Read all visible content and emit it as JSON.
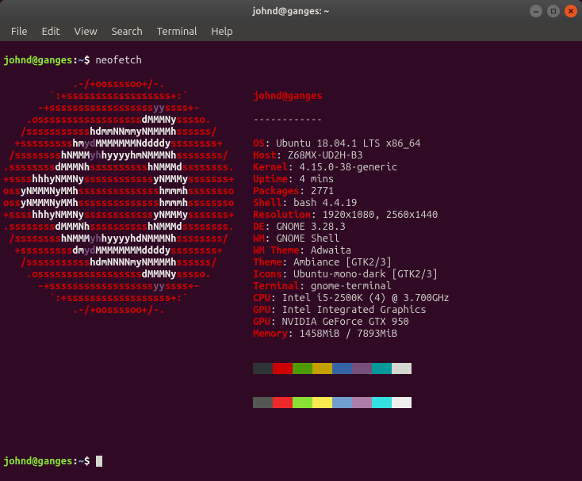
{
  "window": {
    "title": "johnd@ganges: ~"
  },
  "menu": {
    "items": [
      "File",
      "Edit",
      "View",
      "Search",
      "Terminal",
      "Help"
    ]
  },
  "prompt": {
    "user_host": "johnd@ganges",
    "separator": ":",
    "path": "~",
    "dollar": "$",
    "command": "neofetch"
  },
  "ascii": [
    [
      {
        "c": "c-red",
        "t": "            .-/+oossssoo+/-.            "
      }
    ],
    [
      {
        "c": "c-red",
        "t": "        `:+ssssssssssssssssss+:`        "
      }
    ],
    [
      {
        "c": "c-red",
        "t": "      -+ssssssssssssssssss"
      },
      {
        "c": "c-magenta",
        "t": "yy"
      },
      {
        "c": "c-red",
        "t": "ssss+-      "
      }
    ],
    [
      {
        "c": "c-red",
        "t": "    .ossssssssssssssssss"
      },
      {
        "c": "c-white",
        "t": "dMMMNy"
      },
      {
        "c": "c-red",
        "t": "sssso.    "
      }
    ],
    [
      {
        "c": "c-red",
        "t": "   /sssssssssss"
      },
      {
        "c": "c-white",
        "t": "hdmmNNmmyNMMMMh"
      },
      {
        "c": "c-red",
        "t": "ssssss/   "
      }
    ],
    [
      {
        "c": "c-red",
        "t": "  +sssssssss"
      },
      {
        "c": "c-white",
        "t": "hm"
      },
      {
        "c": "c-magenta",
        "t": "yd"
      },
      {
        "c": "c-white",
        "t": "MMMMMMMNddddy"
      },
      {
        "c": "c-red",
        "t": "ssssssss+  "
      }
    ],
    [
      {
        "c": "c-red",
        "t": " /ssssssss"
      },
      {
        "c": "c-white",
        "t": "hNMMM"
      },
      {
        "c": "c-magenta",
        "t": "yh"
      },
      {
        "c": "c-white",
        "t": "hyyyyhmNMMMNh"
      },
      {
        "c": "c-red",
        "t": "ssssssss/ "
      }
    ],
    [
      {
        "c": "c-red",
        "t": ".ssssssss"
      },
      {
        "c": "c-white",
        "t": "dMMMNh"
      },
      {
        "c": "c-red",
        "t": "ssssssssss"
      },
      {
        "c": "c-white",
        "t": "hNMMMd"
      },
      {
        "c": "c-red",
        "t": "ssssssss."
      }
    ],
    [
      {
        "c": "c-red",
        "t": "+ssss"
      },
      {
        "c": "c-white",
        "t": "hhhyNMMNy"
      },
      {
        "c": "c-red",
        "t": "ssssssssssss"
      },
      {
        "c": "c-white",
        "t": "yNMMMy"
      },
      {
        "c": "c-red",
        "t": "sssssss+"
      }
    ],
    [
      {
        "c": "c-red",
        "t": "oss"
      },
      {
        "c": "c-white",
        "t": "yNMMMNyMMh"
      },
      {
        "c": "c-red",
        "t": "ssssssssssssss"
      },
      {
        "c": "c-white",
        "t": "hmmmh"
      },
      {
        "c": "c-red",
        "t": "ssssssso"
      }
    ],
    [
      {
        "c": "c-red",
        "t": "oss"
      },
      {
        "c": "c-white",
        "t": "yNMMMNyMMh"
      },
      {
        "c": "c-red",
        "t": "ssssssssssssss"
      },
      {
        "c": "c-white",
        "t": "hmmmh"
      },
      {
        "c": "c-red",
        "t": "ssssssso"
      }
    ],
    [
      {
        "c": "c-red",
        "t": "+ssss"
      },
      {
        "c": "c-white",
        "t": "hhhyNMMNy"
      },
      {
        "c": "c-red",
        "t": "ssssssssssss"
      },
      {
        "c": "c-white",
        "t": "yNMMMy"
      },
      {
        "c": "c-red",
        "t": "sssssss+"
      }
    ],
    [
      {
        "c": "c-red",
        "t": ".ssssssss"
      },
      {
        "c": "c-white",
        "t": "dMMMNh"
      },
      {
        "c": "c-red",
        "t": "ssssssssss"
      },
      {
        "c": "c-white",
        "t": "hNMMMd"
      },
      {
        "c": "c-red",
        "t": "ssssssss."
      }
    ],
    [
      {
        "c": "c-red",
        "t": " /ssssssss"
      },
      {
        "c": "c-white",
        "t": "hNMMM"
      },
      {
        "c": "c-magenta",
        "t": "yh"
      },
      {
        "c": "c-white",
        "t": "hyyyyhdNMMMNh"
      },
      {
        "c": "c-red",
        "t": "ssssssss/ "
      }
    ],
    [
      {
        "c": "c-red",
        "t": "  +sssssssss"
      },
      {
        "c": "c-white",
        "t": "dm"
      },
      {
        "c": "c-magenta",
        "t": "yd"
      },
      {
        "c": "c-white",
        "t": "MMMMMMMMddddy"
      },
      {
        "c": "c-red",
        "t": "ssssssss+  "
      }
    ],
    [
      {
        "c": "c-red",
        "t": "   /sssssssssss"
      },
      {
        "c": "c-white",
        "t": "hdmNNNNmyNMMMMh"
      },
      {
        "c": "c-red",
        "t": "ssssss/   "
      }
    ],
    [
      {
        "c": "c-red",
        "t": "    .ossssssssssssssssss"
      },
      {
        "c": "c-white",
        "t": "dMMMNy"
      },
      {
        "c": "c-red",
        "t": "sssso.    "
      }
    ],
    [
      {
        "c": "c-red",
        "t": "      -+ssssssssssssssssss"
      },
      {
        "c": "c-magenta",
        "t": "yy"
      },
      {
        "c": "c-red",
        "t": "ssss+-      "
      }
    ],
    [
      {
        "c": "c-red",
        "t": "        `:+ssssssssssssssssss+:`        "
      }
    ],
    [
      {
        "c": "c-red",
        "t": "            .-/+oossssoo+/-.            "
      }
    ]
  ],
  "info": {
    "title": "johnd@ganges",
    "dashes": "------------",
    "rows": [
      {
        "label": "OS",
        "value": "Ubuntu 18.04.1 LTS x86_64"
      },
      {
        "label": "Host",
        "value": "Z68MX-UD2H-B3"
      },
      {
        "label": "Kernel",
        "value": "4.15.0-38-generic"
      },
      {
        "label": "Uptime",
        "value": "4 mins"
      },
      {
        "label": "Packages",
        "value": "2771"
      },
      {
        "label": "Shell",
        "value": "bash 4.4.19"
      },
      {
        "label": "Resolution",
        "value": "1920x1080, 2560x1440"
      },
      {
        "label": "DE",
        "value": "GNOME 3.28.3"
      },
      {
        "label": "WM",
        "value": "GNOME Shell"
      },
      {
        "label": "WM Theme",
        "value": "Adwaita"
      },
      {
        "label": "Theme",
        "value": "Ambiance [GTK2/3]"
      },
      {
        "label": "Icons",
        "value": "Ubuntu-mono-dark [GTK2/3]"
      },
      {
        "label": "Terminal",
        "value": "gnome-terminal"
      },
      {
        "label": "CPU",
        "value": "Intel i5-2500K (4) @ 3.700GHz"
      },
      {
        "label": "GPU",
        "value": "Intel Integrated Graphics"
      },
      {
        "label": "GPU",
        "value": "NVIDIA GeForce GTX 950"
      },
      {
        "label": "Memory",
        "value": "1458MiB / 7893MiB"
      }
    ]
  },
  "palette": [
    "#2e3436",
    "#cc0000",
    "#4e9a06",
    "#c4a000",
    "#3465a4",
    "#75507b",
    "#06989a",
    "#d3d7cf",
    "#555753",
    "#ef2929",
    "#8ae234",
    "#fce94f",
    "#729fcf",
    "#ad7fa8",
    "#34e2e2",
    "#eeeeec"
  ]
}
